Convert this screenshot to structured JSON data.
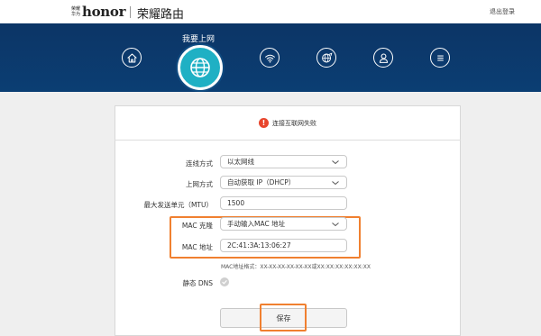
{
  "header": {
    "logo_small_top": "荣耀",
    "logo_small_bottom": "华为",
    "logo_text": "honor",
    "title": "荣耀路由",
    "logout": "退出登录"
  },
  "nav": {
    "active_label": "我要上网",
    "items": [
      "home-icon",
      "globe-icon",
      "wifi-icon",
      "network-settings-icon",
      "user-icon",
      "menu-icon"
    ]
  },
  "alert": {
    "icon": "!",
    "text": "连接互联网失败"
  },
  "form": {
    "connection_type": {
      "label": "连线方式",
      "value": "以太网线"
    },
    "internet_mode": {
      "label": "上网方式",
      "value": "自动获取 IP（DHCP）"
    },
    "mtu": {
      "label": "最大发送单元（MTU）",
      "value": "1500"
    },
    "mac_clone": {
      "label": "MAC 克隆",
      "value": "手动输入MAC 地址"
    },
    "mac_address": {
      "label": "MAC 地址",
      "value": "2C:41:3A:13:06:27"
    },
    "mac_hint": "MAC地址格式：XX-XX-XX-XX-XX-XX或XX:XX:XX:XX:XX:XX",
    "static_dns": {
      "label": "静态 DNS"
    },
    "save": "保存"
  },
  "colors": {
    "banner": "#0c3566",
    "active_nav": "#1fb0c4",
    "highlight": "#f08030",
    "alert": "#e8452c"
  }
}
